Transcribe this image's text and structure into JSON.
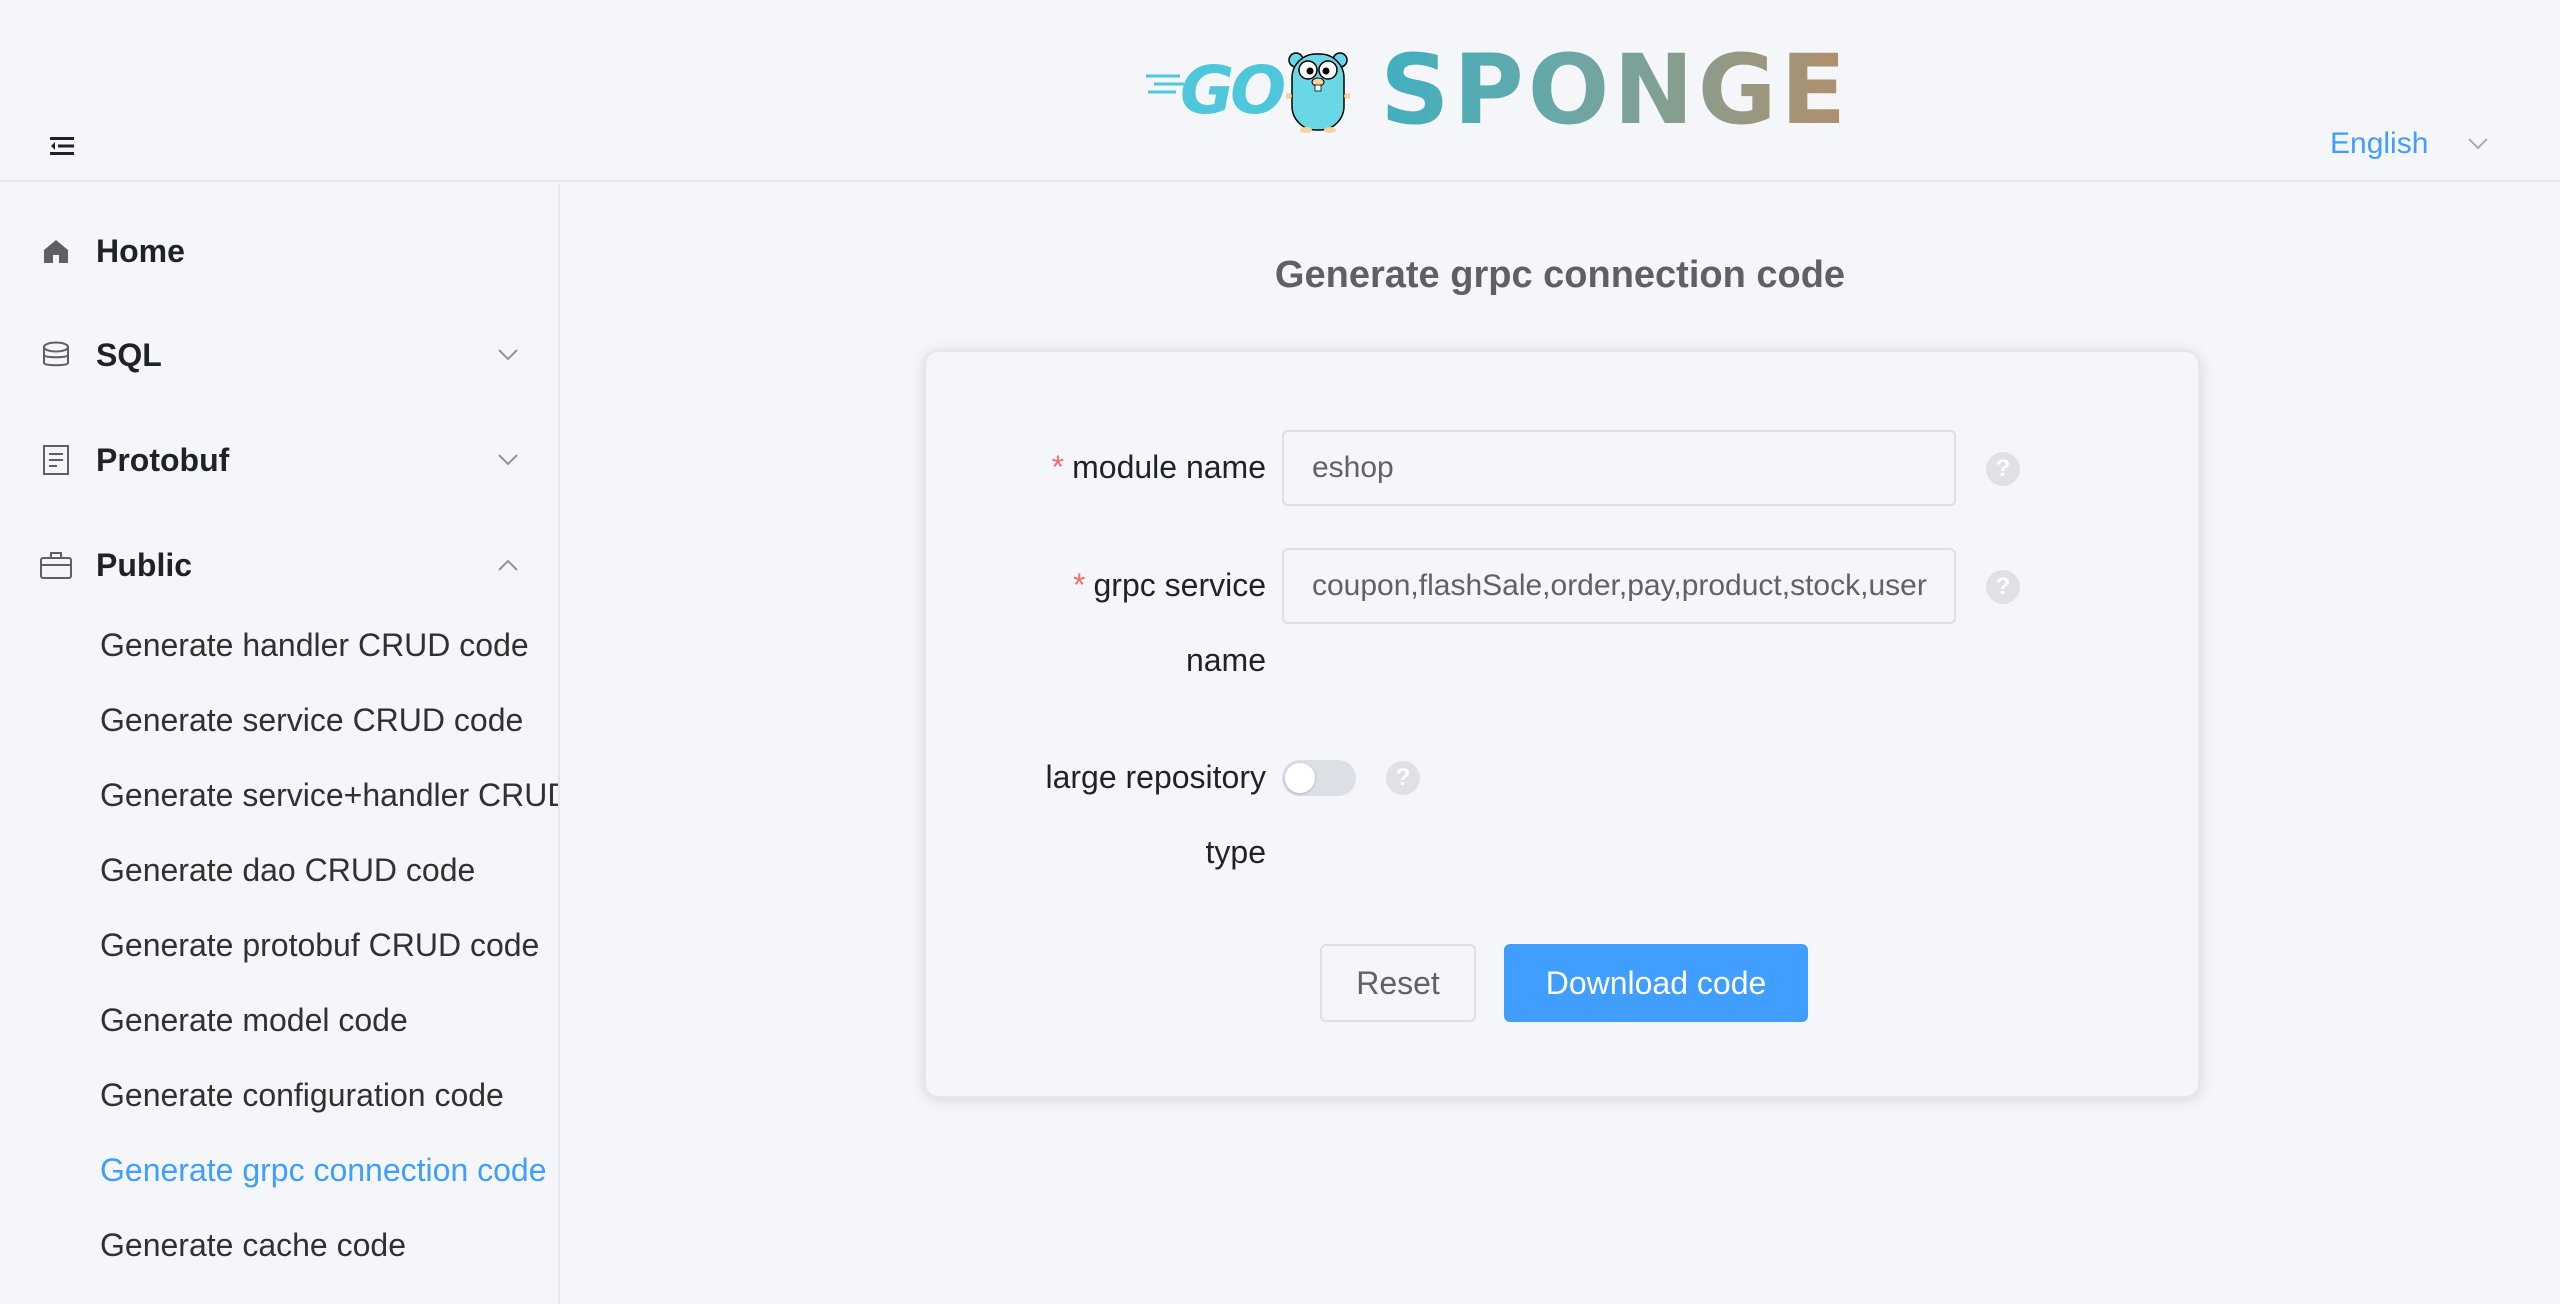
{
  "header": {
    "logo_go": "GO",
    "logo_brand": "SPONGE",
    "language": "English"
  },
  "sidebar": {
    "items": [
      {
        "label": "Home",
        "icon": "home-icon"
      },
      {
        "label": "SQL",
        "icon": "database-icon",
        "expanded": false
      },
      {
        "label": "Protobuf",
        "icon": "document-icon",
        "expanded": false
      },
      {
        "label": "Public",
        "icon": "briefcase-icon",
        "expanded": true
      }
    ],
    "public_subitems": [
      "Generate handler CRUD code",
      "Generate service CRUD code",
      "Generate service+handler CRUD code",
      "Generate dao CRUD code",
      "Generate protobuf CRUD code",
      "Generate model code",
      "Generate configuration code",
      "Generate grpc connection code",
      "Generate cache code"
    ],
    "active_subitem": "Generate grpc connection code"
  },
  "main": {
    "title": "Generate grpc connection code",
    "form": {
      "module_name_label": "module name",
      "module_name_value": "eshop",
      "grpc_service_label_line1": "grpc service",
      "grpc_service_label_line2": "name",
      "grpc_service_value": "coupon,flashSale,order,pay,product,stock,user",
      "large_repo_label_line1": "large repository",
      "large_repo_label_line2": "type",
      "large_repo_enabled": false,
      "required_mark": "*",
      "help_glyph": "?"
    },
    "buttons": {
      "reset": "Reset",
      "download": "Download code"
    }
  },
  "colors": {
    "accent": "#409eff",
    "required": "#f56c6c",
    "background": "#f5f6f9"
  }
}
